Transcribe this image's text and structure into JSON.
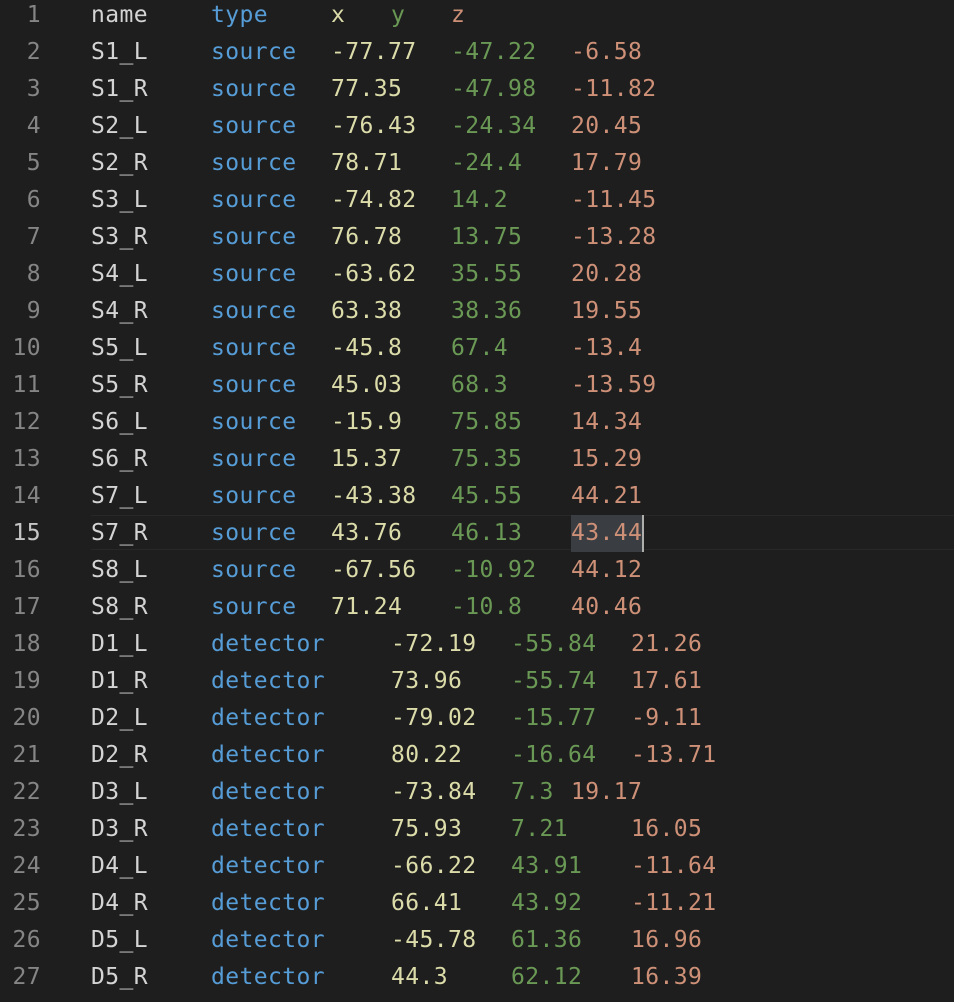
{
  "editor": {
    "colors": {
      "background": "#1e1e1e",
      "line_number": "#858585",
      "name": "#d4d4d4",
      "type": "#569cd6",
      "x": "#dcdcaa",
      "y": "#6a9955",
      "z": "#ce9178"
    },
    "current_line": 15,
    "header": [
      "name",
      "type",
      "x",
      "y",
      "z"
    ],
    "rows": [
      [
        "S1_L",
        "source",
        "-77.77",
        "-47.22",
        "-6.58"
      ],
      [
        "S1_R",
        "source",
        "77.35",
        "-47.98",
        "-11.82"
      ],
      [
        "S2_L",
        "source",
        "-76.43",
        "-24.34",
        "20.45"
      ],
      [
        "S2_R",
        "source",
        "78.71",
        "-24.4",
        "17.79"
      ],
      [
        "S3_L",
        "source",
        "-74.82",
        "14.2",
        "-11.45"
      ],
      [
        "S3_R",
        "source",
        "76.78",
        "13.75",
        "-13.28"
      ],
      [
        "S4_L",
        "source",
        "-63.62",
        "35.55",
        "20.28"
      ],
      [
        "S4_R",
        "source",
        "63.38",
        "38.36",
        "19.55"
      ],
      [
        "S5_L",
        "source",
        "-45.8",
        "67.4",
        "-13.4"
      ],
      [
        "S5_R",
        "source",
        "45.03",
        "68.3",
        "-13.59"
      ],
      [
        "S6_L",
        "source",
        "-15.9",
        "75.85",
        "14.34"
      ],
      [
        "S6_R",
        "source",
        "15.37",
        "75.35",
        "15.29"
      ],
      [
        "S7_L",
        "source",
        "-43.38",
        "45.55",
        "44.21"
      ],
      [
        "S7_R",
        "source",
        "43.76",
        "46.13",
        "43.44"
      ],
      [
        "S8_L",
        "source",
        "-67.56",
        "-10.92",
        "44.12"
      ],
      [
        "S8_R",
        "source",
        "71.24",
        "-10.8",
        "40.46"
      ],
      [
        "D1_L",
        "detector",
        "-72.19",
        "-55.84",
        "21.26"
      ],
      [
        "D1_R",
        "detector",
        "73.96",
        "-55.74",
        "17.61"
      ],
      [
        "D2_L",
        "detector",
        "-79.02",
        "-15.77",
        "-9.11"
      ],
      [
        "D2_R",
        "detector",
        "80.22",
        "-16.64",
        "-13.71"
      ],
      [
        "D3_L",
        "detector",
        "-73.84",
        "7.3",
        "19.17"
      ],
      [
        "D3_R",
        "detector",
        "75.93",
        "7.21",
        "16.05"
      ],
      [
        "D4_L",
        "detector",
        "-66.22",
        "43.91",
        "-11.64"
      ],
      [
        "D4_R",
        "detector",
        "66.41",
        "43.92",
        "-11.21"
      ],
      [
        "D5_L",
        "detector",
        "-45.78",
        "61.36",
        "16.96"
      ],
      [
        "D5_R",
        "detector",
        "44.3",
        "62.12",
        "16.39"
      ]
    ]
  }
}
